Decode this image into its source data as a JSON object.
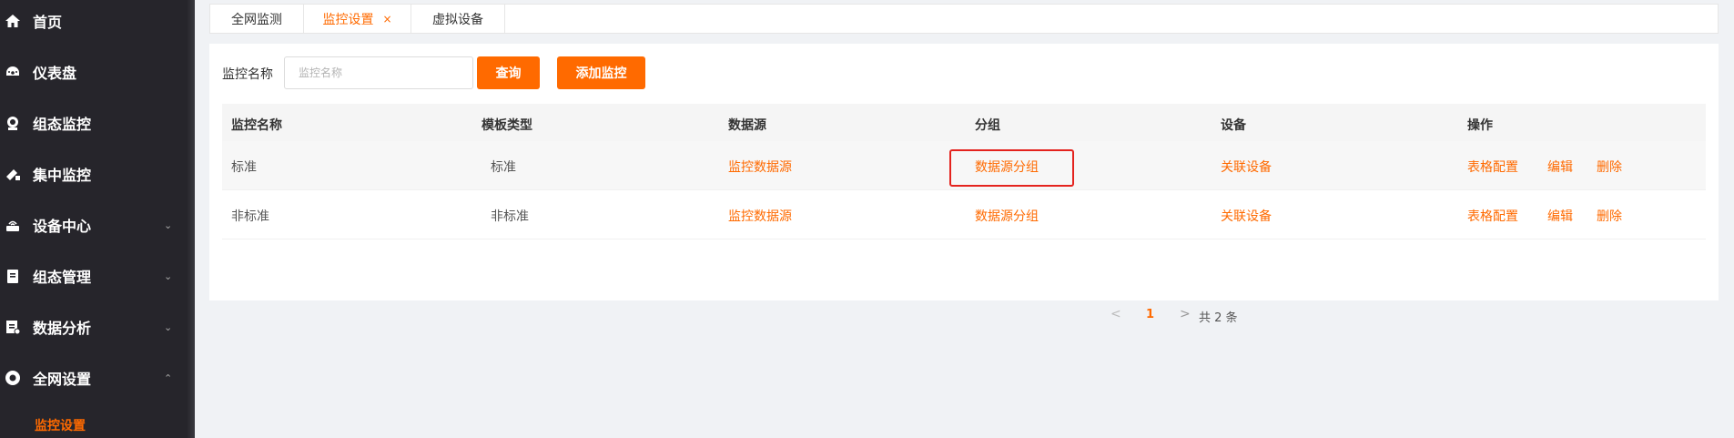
{
  "sidebar": {
    "items": [
      {
        "label": "首页",
        "icon": "home-icon",
        "arrow": ""
      },
      {
        "label": "仪表盘",
        "icon": "dashboard-icon",
        "arrow": ""
      },
      {
        "label": "组态监控",
        "icon": "monitor-icon",
        "arrow": ""
      },
      {
        "label": "集中监控",
        "icon": "centralized-monitor-icon",
        "arrow": ""
      },
      {
        "label": "设备中心",
        "icon": "router-icon",
        "arrow": "⌄"
      },
      {
        "label": "组态管理",
        "icon": "clipboard-icon",
        "arrow": "⌄"
      },
      {
        "label": "数据分析",
        "icon": "report-icon",
        "arrow": "⌄"
      },
      {
        "label": "全网设置",
        "icon": "settings-icon",
        "arrow": "⌃"
      }
    ],
    "active_sub": "监控设置"
  },
  "tabs": [
    {
      "label": "全网监测",
      "active": false,
      "close": ""
    },
    {
      "label": "监控设置",
      "active": true,
      "close": "×"
    },
    {
      "label": "虚拟设备",
      "active": false,
      "close": ""
    }
  ],
  "search": {
    "label": "监控名称",
    "placeholder": "监控名称",
    "query_button": "查询",
    "add_button": "添加监控"
  },
  "table": {
    "columns": [
      "监控名称",
      "模板类型",
      "数据源",
      "分组",
      "设备",
      "操作"
    ],
    "rows": [
      {
        "name": "标准",
        "template": "标准",
        "datasource": "监控数据源",
        "group": "数据源分组",
        "device": "关联设备",
        "actions": [
          "表格配置",
          "编辑",
          "删除"
        ]
      },
      {
        "name": "非标准",
        "template": "非标准",
        "datasource": "监控数据源",
        "group": "数据源分组",
        "device": "关联设备",
        "actions": [
          "表格配置",
          "编辑",
          "删除"
        ]
      }
    ]
  },
  "pagination": {
    "prev": "<",
    "current_page": "1",
    "next": ">",
    "total": "共 2 条"
  },
  "colors": {
    "accent": "#ff6a00",
    "sidebar_bg": "#26252b",
    "highlight": "#e4231e"
  }
}
